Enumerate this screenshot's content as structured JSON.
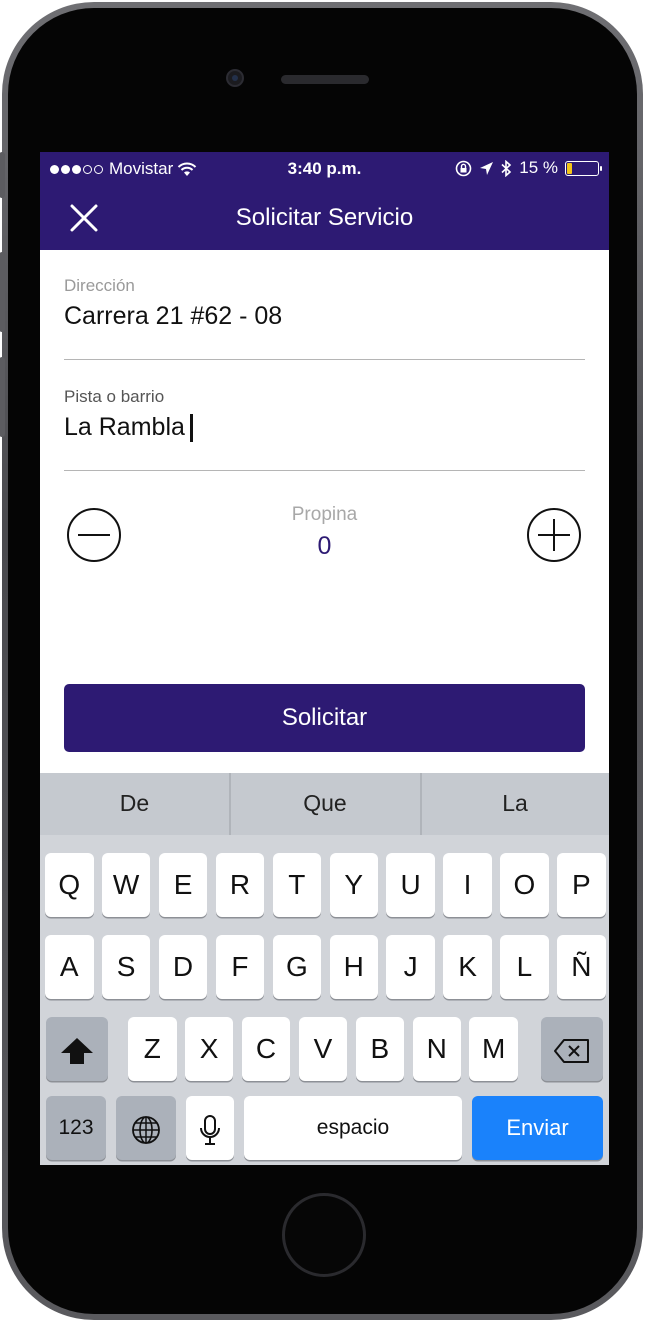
{
  "status_bar": {
    "carrier": "Movistar",
    "time": "3:40 p.m.",
    "battery_text": "15 %",
    "battery_level": 0.15,
    "battery_color": "#f5c518"
  },
  "nav": {
    "title": "Solicitar Servicio",
    "close_icon": "close-icon"
  },
  "form": {
    "address": {
      "label": "Dirección",
      "value": "Carrera 21 #62 - 08"
    },
    "hint": {
      "label": "Pista o barrio",
      "value": "La Rambla"
    },
    "tip": {
      "label": "Propina",
      "value": "0"
    },
    "submit_label": "Solicitar"
  },
  "keyboard": {
    "suggestions": [
      "De",
      "Que",
      "La"
    ],
    "rows": [
      [
        "Q",
        "W",
        "E",
        "R",
        "T",
        "Y",
        "U",
        "I",
        "O",
        "P"
      ],
      [
        "A",
        "S",
        "D",
        "F",
        "G",
        "H",
        "J",
        "K",
        "L",
        "Ñ"
      ],
      [
        "Z",
        "X",
        "C",
        "V",
        "B",
        "N",
        "M"
      ]
    ],
    "numbers_key": "123",
    "space_key": "espacio",
    "return_key": "Enviar"
  },
  "colors": {
    "brand": "#2d1a73",
    "return_key": "#1a82fb"
  }
}
